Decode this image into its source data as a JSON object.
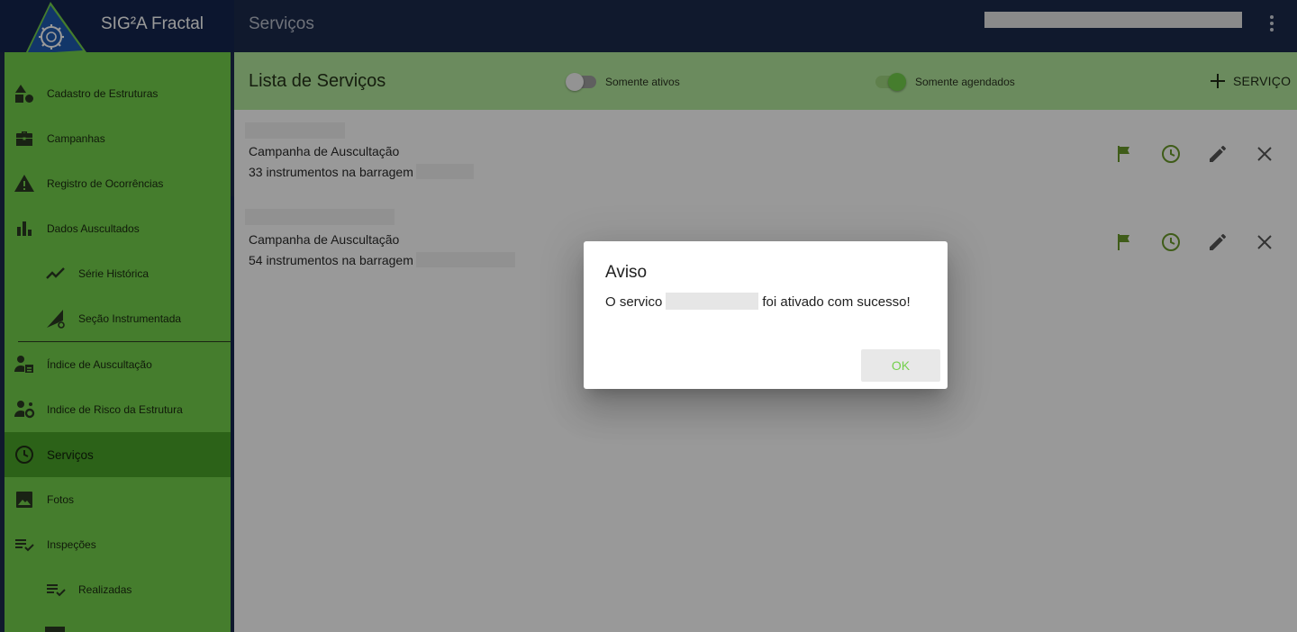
{
  "app": {
    "title": "SIG²A Fractal",
    "page_title": "Serviços"
  },
  "colors": {
    "accent": "#74d04c",
    "accent_dark": "#4aa329",
    "header_bg": "#1b2b4b",
    "icon_green": "#6a9a2a"
  },
  "sidebar": {
    "items": [
      {
        "label": "Cadastro de Estruturas",
        "icon": "shapes-icon",
        "sub": false
      },
      {
        "label": "Campanhas",
        "icon": "briefcase-icon",
        "sub": false
      },
      {
        "label": "Registro de Ocorrências",
        "icon": "warning-icon",
        "sub": false
      },
      {
        "label": "Dados Auscultados",
        "icon": "bar-chart-icon",
        "sub": false
      },
      {
        "label": "Série Histórica",
        "icon": "trending-icon",
        "sub": true
      },
      {
        "label": "Seção Instrumentada",
        "icon": "gear-triangle-icon",
        "sub": true
      },
      {
        "label": "Índice de Auscultação",
        "icon": "person-badge-icon",
        "sub": false
      },
      {
        "label": "Indice de Risco da Estrutura",
        "icon": "person-gear-icon",
        "sub": false
      },
      {
        "label": "Serviços",
        "icon": "clock-icon",
        "sub": false,
        "active": true
      },
      {
        "label": "Fotos",
        "icon": "image-icon",
        "sub": false
      },
      {
        "label": "Inspeções",
        "icon": "checklist-icon",
        "sub": false
      },
      {
        "label": "Realizadas",
        "icon": "checklist-icon",
        "sub": true
      }
    ]
  },
  "list": {
    "title": "Lista de Serviços",
    "toggle_active": {
      "label": "Somente ativos",
      "on": false
    },
    "toggle_scheduled": {
      "label": "Somente agendados",
      "on": true
    },
    "add_label": "SERVIÇO",
    "rows": [
      {
        "type": "Campanha de Auscultação",
        "instruments": "33 instrumentos na barragem"
      },
      {
        "type": "Campanha de Auscultação",
        "instruments": "54 instrumentos na barragem"
      }
    ]
  },
  "dialog": {
    "title": "Aviso",
    "msg_prefix": "O servico",
    "msg_suffix": "foi ativado com sucesso!",
    "ok_label": "OK"
  }
}
